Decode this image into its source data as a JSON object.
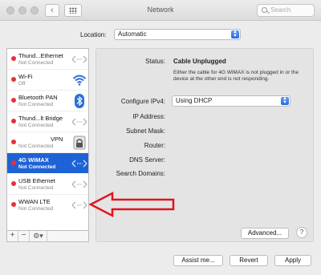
{
  "window": {
    "title": "Network"
  },
  "toolbar": {
    "back": "‹",
    "forward": "›",
    "search_placeholder": "Search"
  },
  "location": {
    "label": "Location:",
    "value": "Automatic"
  },
  "services": [
    {
      "name": "Thund...Ethernet",
      "status": "Not Connected",
      "icon": "ethernet-arrows-icon"
    },
    {
      "name": "Wi-Fi",
      "status": "Off",
      "icon": "wifi-icon"
    },
    {
      "name": "Bluetooth PAN",
      "status": "Not Connected",
      "icon": "bluetooth-icon"
    },
    {
      "name": "Thund...lt Bridge",
      "status": "Not Connected",
      "icon": "ethernet-arrows-icon"
    },
    {
      "name": "VPN",
      "status": "Not Connected",
      "icon": "lock-icon"
    },
    {
      "name": "4G WiMAX",
      "status": "Not Connected",
      "icon": "ethernet-arrows-icon"
    },
    {
      "name": "USB Ethernet",
      "status": "Not Connected",
      "icon": "ethernet-arrows-icon"
    },
    {
      "name": "WWAN LTE",
      "status": "Not Connected",
      "icon": "ethernet-arrows-icon"
    }
  ],
  "sidebar_footer": {
    "add": "+",
    "remove": "−",
    "gear": "⚙▾"
  },
  "detail": {
    "status_label": "Status:",
    "status_value": "Cable Unplugged",
    "status_note": "Either the cable for 4G WiMAX is not plugged in or the device at the other end is not responding.",
    "configure_label": "Configure IPv4:",
    "configure_value": "Using DHCP",
    "ip_label": "IP Address:",
    "subnet_label": "Subnet Mask:",
    "router_label": "Router:",
    "dns_label": "DNS Server:",
    "search_domains_label": "Search Domains:",
    "advanced_button": "Advanced...",
    "help_button": "?"
  },
  "footer": {
    "assist": "Assist me...",
    "revert": "Revert",
    "apply": "Apply"
  },
  "colors": {
    "selection": "#1e63d6",
    "status_dot": "#e8303a",
    "annotation_arrow": "#e0141e"
  }
}
